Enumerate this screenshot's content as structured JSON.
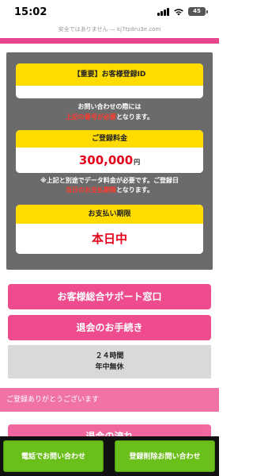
{
  "status_bar": {
    "time": "15:02",
    "battery": "45"
  },
  "url_bar": {
    "text": "安全ではありません — kj7tp8ru3e.com"
  },
  "id_card": {
    "title": "【重要】お客様登録ID"
  },
  "note1": {
    "line1": "お問い合わせの際には",
    "red": "上記の番号が必要",
    "rest": "となります。"
  },
  "fee_card": {
    "title": "ご登録料金",
    "amount": "300,000",
    "unit": "円"
  },
  "note2": {
    "line1": "※上記と別途でデータ料金が必要です。ご登録日",
    "red": "当日のお支払期限",
    "rest": "となります。"
  },
  "deadline_card": {
    "title": "お支払い期限",
    "value": "本日中"
  },
  "buttons": {
    "support": "お客様総合サポート窓口",
    "cancel": "退会のお手続き"
  },
  "hours": {
    "line1": "２４時間",
    "line2": "年中無休"
  },
  "thanks": {
    "text": "ご登録ありがとうございます"
  },
  "partial": {
    "text": "退会の流れ"
  },
  "bottom": {
    "phone": "電話でお問い合わせ",
    "unregister": "登録削除お問い合わせ"
  }
}
